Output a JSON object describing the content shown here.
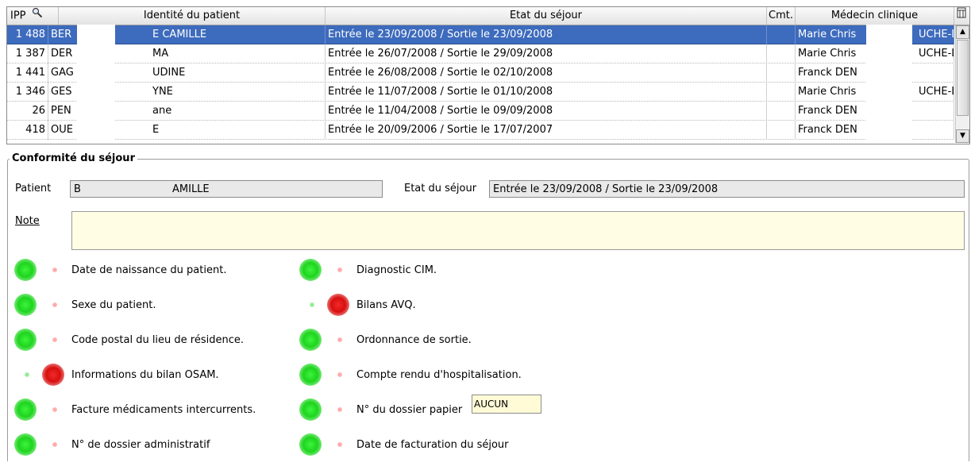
{
  "grid": {
    "headers": {
      "ipp": "IPP",
      "identite": "Identité du patient",
      "etat": "Etat du séjour",
      "cmt": "Cmt.",
      "medecin": "Médecin clinique"
    },
    "rows": [
      {
        "ipp": "1 488",
        "identite": "BER",
        "identite_end": "E CAMILLE",
        "etat": "Entrée le 23/09/2008 / Sortie le 23/09/2008",
        "cmt": "",
        "medecin": "Marie Chris",
        "medecin_end": "UCHE-LI",
        "selected": true
      },
      {
        "ipp": "1 387",
        "identite": "DER",
        "identite_end": "MA",
        "etat": "Entrée le 26/07/2008 / Sortie le 29/09/2008",
        "cmt": "",
        "medecin": "Marie Chris",
        "medecin_end": "UCHE-LI",
        "selected": false
      },
      {
        "ipp": "1 441",
        "identite": "GAG",
        "identite_end": "UDINE",
        "etat": "Entrée le 26/08/2008 / Sortie le 02/10/2008",
        "cmt": "",
        "medecin": "Franck DEN",
        "medecin_end": "",
        "selected": false
      },
      {
        "ipp": "1 346",
        "identite": "GES",
        "identite_end": "YNE",
        "etat": "Entrée le 11/07/2008 / Sortie le 01/10/2008",
        "cmt": "",
        "medecin": "Marie Chris",
        "medecin_end": "UCHE-LI",
        "selected": false
      },
      {
        "ipp": "26",
        "identite": "PEN",
        "identite_end": "ane",
        "etat": "Entrée le 11/04/2008 / Sortie le 09/09/2008",
        "cmt": "",
        "medecin": "Franck DEN",
        "medecin_end": "",
        "selected": false
      },
      {
        "ipp": "418",
        "identite": "OUE",
        "identite_end": "E",
        "etat": "Entrée le 20/09/2006 / Sortie le 17/07/2007",
        "cmt": "",
        "medecin": "Franck DEN",
        "medecin_end": "",
        "selected": false
      }
    ]
  },
  "conformite": {
    "title": "Conformité du séjour",
    "patient_label": "Patient",
    "patient_value_start": "B",
    "patient_value_end": "AMILLE",
    "etat_label": "Etat du séjour",
    "etat_value": "Entrée le 23/09/2008 / Sortie le 23/09/2008",
    "note_label": "Note",
    "left_checks": [
      {
        "label": "Date de naissance du patient.",
        "ok": true
      },
      {
        "label": "Sexe du patient.",
        "ok": true
      },
      {
        "label": "Code postal du lieu de résidence.",
        "ok": true
      },
      {
        "label": "Informations du bilan OSAM.",
        "ok": false
      },
      {
        "label": "Facture médicaments intercurrents.",
        "ok": true
      },
      {
        "label": "N° de dossier administratif",
        "ok": true
      }
    ],
    "right_checks": [
      {
        "label": "Diagnostic CIM.",
        "ok": true
      },
      {
        "label": "Bilans AVQ.",
        "ok": false
      },
      {
        "label": "Ordonnance de sortie.",
        "ok": true
      },
      {
        "label": "Compte rendu d'hospitalisation.",
        "ok": true
      },
      {
        "label": "N° du dossier papier",
        "ok": true
      },
      {
        "label": "Date de facturation du séjour",
        "ok": true
      }
    ],
    "dossier_papier_value": "AUCUN"
  },
  "colors": {
    "selection": "#3d6bbd",
    "ok": "#1fd41f",
    "ko": "#d80f0f",
    "note_bg": "#fffde3"
  }
}
